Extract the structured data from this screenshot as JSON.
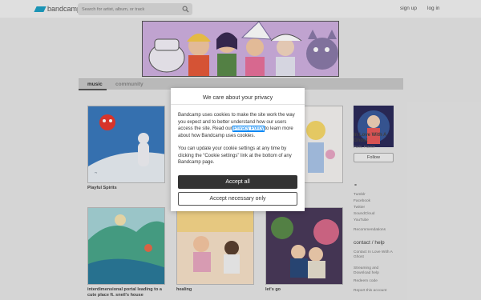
{
  "topbar": {
    "logo_text": "bandcamp",
    "search_placeholder": "Search for artist, album, or track",
    "signup": "sign up",
    "login": "log in"
  },
  "tabs": [
    {
      "label": "music",
      "active": true
    },
    {
      "label": "community",
      "active": false
    }
  ],
  "albums": [
    {
      "title": "Playful Spirits"
    },
    {
      "title": "interdimensional portal leading to a cute place ft. sneil's house"
    },
    {
      "title": "healing"
    },
    {
      "title": "let's go"
    }
  ],
  "artist": {
    "name": "In Love With A Ghost",
    "location": "Paris, France",
    "follow_label": "Follow",
    "links": [
      "Tumblr",
      "Facebook",
      "Twitter",
      "SoundCloud",
      "YouTube"
    ],
    "recommendations": "Recommendations",
    "contact_heading": "contact / help",
    "contact_links": [
      "Contact In Love With A Ghost",
      "Streaming and Download help",
      "Redeem code",
      "Report this account"
    ]
  },
  "cookie_dialog": {
    "title": "We care about your privacy",
    "p1_before": "Bandcamp uses cookies to make the site work the way you expect and to better understand how our users access the site. Read our ",
    "privacy_link": "Privacy Policy",
    "p1_after": " to learn more about how Bandcamp uses cookies.",
    "p2": "You can update your cookie settings at any time by clicking the “Cookie settings” link at the bottom of any Bandcamp page.",
    "accept_all": "Accept all",
    "accept_necessary": "Accept necessary only"
  },
  "colors": {
    "accent": "#1da0c3",
    "link": "#0687f5",
    "primary_button": "#333333"
  }
}
